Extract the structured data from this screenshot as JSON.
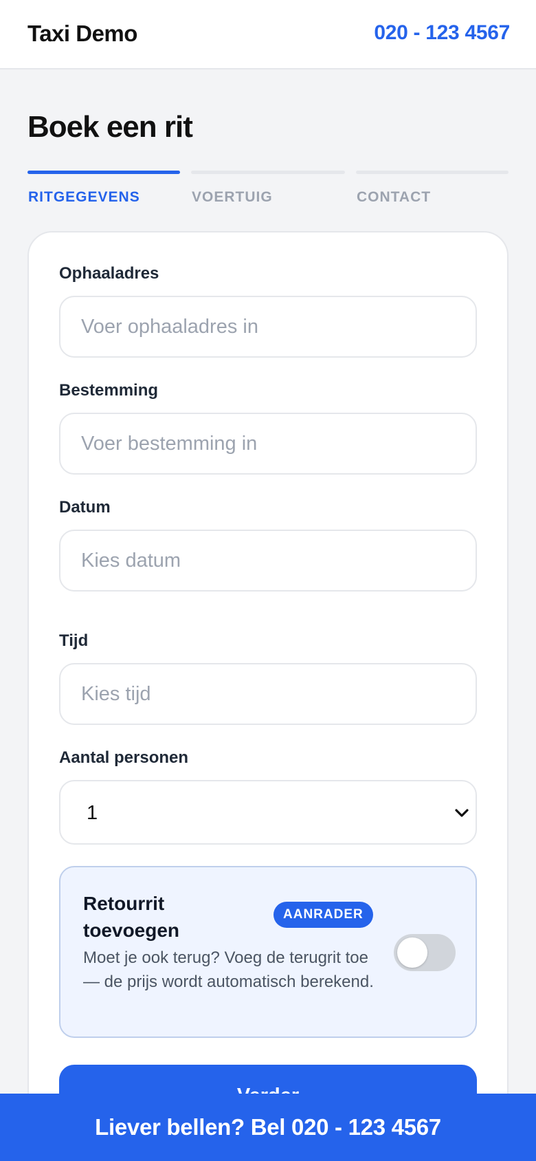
{
  "header": {
    "brand": "Taxi Demo",
    "phone": "020 - 123 4567"
  },
  "page": {
    "title": "Boek een rit"
  },
  "steps": [
    {
      "label": "RITGEGEVENS",
      "active": true
    },
    {
      "label": "VOERTUIG",
      "active": false
    },
    {
      "label": "CONTACT",
      "active": false
    }
  ],
  "form": {
    "pickup": {
      "label": "Ophaaladres",
      "placeholder": "Voer ophaaladres in",
      "value": ""
    },
    "destination": {
      "label": "Bestemming",
      "placeholder": "Voer bestemming in",
      "value": ""
    },
    "date": {
      "label": "Datum",
      "placeholder": "Kies datum",
      "value": ""
    },
    "time": {
      "label": "Tijd",
      "placeholder": "Kies tijd",
      "value": ""
    },
    "passengers": {
      "label": "Aantal personen",
      "value": "1"
    },
    "return_trip": {
      "title": "Retourrit toevoegen",
      "badge": "AANRADER",
      "description": "Moet je ook terug? Voeg de terugrit toe — de prijs wordt automatisch berekend.",
      "enabled": false
    },
    "next_label": "Verder"
  },
  "call_bar": {
    "text": "Liever bellen? Bel 020 - 123 4567"
  },
  "colors": {
    "accent": "#2563eb",
    "background": "#f3f4f6",
    "muted": "#9ca3af",
    "retour_background": "#eff4ff"
  },
  "icons": {
    "select_caret": "chevron-down-icon"
  }
}
